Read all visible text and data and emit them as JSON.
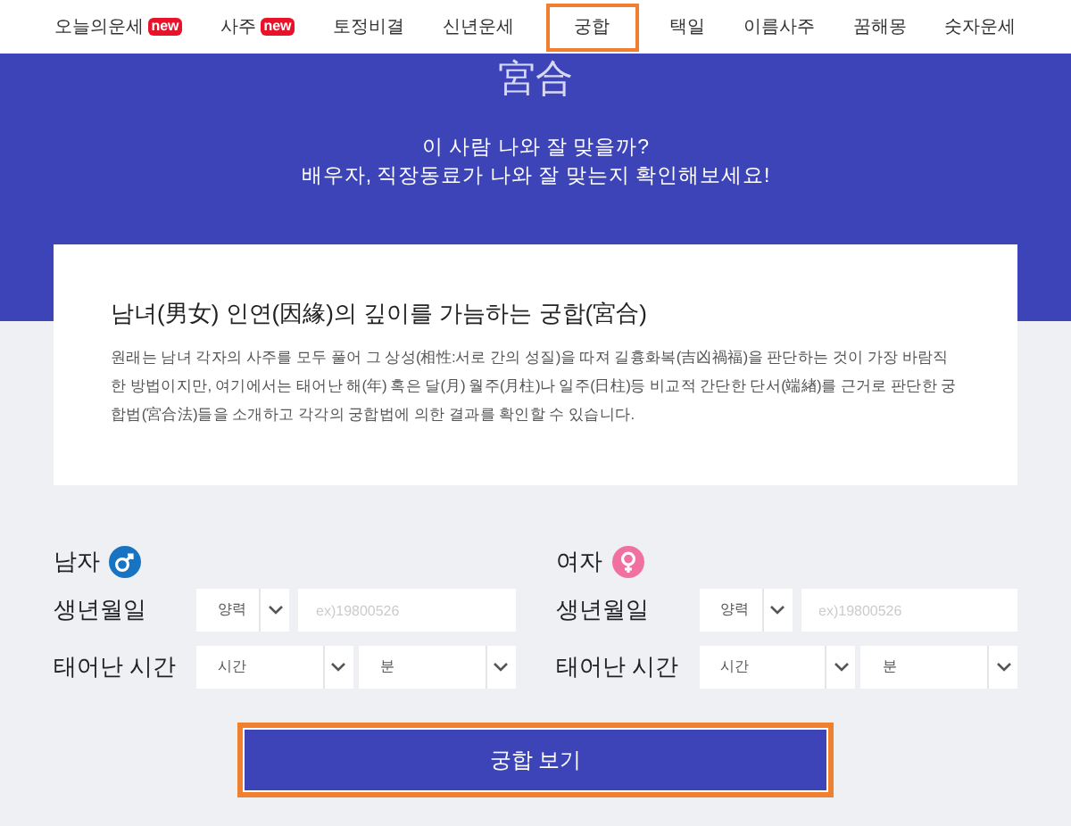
{
  "nav": [
    {
      "label": "오늘의운세",
      "badge": "new",
      "selected": false
    },
    {
      "label": "사주",
      "badge": "new",
      "selected": false
    },
    {
      "label": "토정비결",
      "selected": false
    },
    {
      "label": "신년운세",
      "selected": false
    },
    {
      "label": "궁합",
      "selected": true
    },
    {
      "label": "택일",
      "selected": false
    },
    {
      "label": "이름사주",
      "selected": false
    },
    {
      "label": "꿈해몽",
      "selected": false
    },
    {
      "label": "숫자운세",
      "selected": false
    }
  ],
  "hero": {
    "title": "宮合",
    "lines": [
      "이 사람 나와 잘 맞을까?",
      "배우자, 직장동료가 나와 잘 맞는지 확인해보세요!"
    ]
  },
  "intro": {
    "title": "남녀(男女) 인연(因緣)의 깊이를 가늠하는 궁합(宮合)",
    "body": "원래는 남녀 각자의 사주를 모두 풀어 그 상성(相性:서로 간의 성질)을 따져 길흉화복(吉凶禍福)을 판단하는 것이 가장 바람직한 방법이지만, 여기에서는 태어난 해(年) 혹은 달(月) 월주(月柱)나 일주(日柱)등 비교적 간단한 단서(端緖)를 근거로 판단한 궁합법(宮合法)들을 소개하고 각각의 궁합법에 의한 결과를 확인할 수 있습니다."
  },
  "persons": [
    {
      "label": "남자",
      "kind": "male",
      "birth_label": "생년월일",
      "calendar": "양력",
      "birth_placeholder": "ex)19800526",
      "time_label": "태어난 시간",
      "hour": "시간",
      "minute": "분"
    },
    {
      "label": "여자",
      "kind": "female",
      "birth_label": "생년월일",
      "calendar": "양력",
      "birth_placeholder": "ex)19800526",
      "time_label": "태어난 시간",
      "hour": "시간",
      "minute": "분"
    }
  ],
  "submit": {
    "label": "궁합 보기"
  }
}
